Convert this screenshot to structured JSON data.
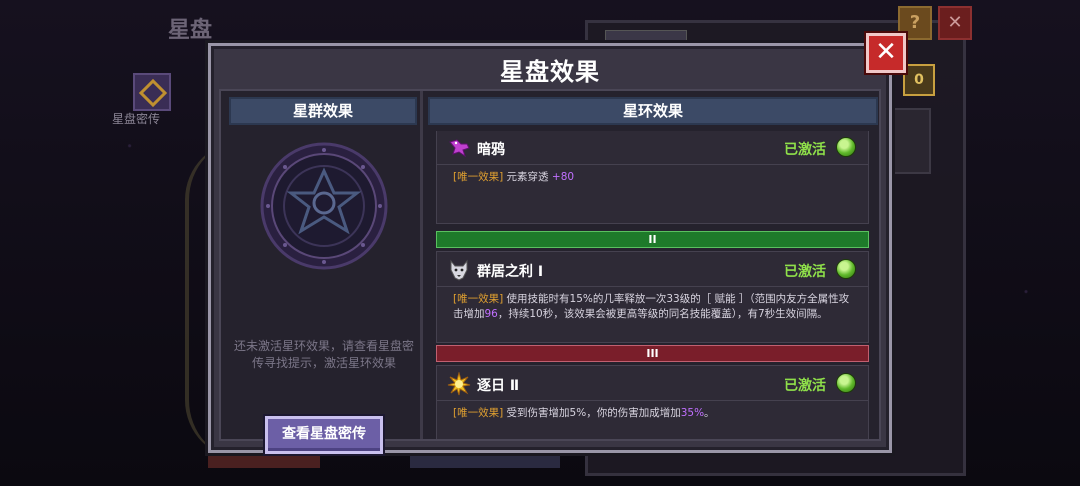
{
  "background": {
    "title": "星盘",
    "left_icon_label": "星盘密传",
    "help_icon": "?",
    "coin_label": "0"
  },
  "modal": {
    "title": "星盘效果",
    "close_icon": "close-icon",
    "left_panel": {
      "header": "星群效果",
      "hint": "还未激活星环效果，请查看星盘密传寻找提示，激活星环效果",
      "button_label": "查看星盘密传"
    },
    "right_panel": {
      "header": "星环效果",
      "entries": [
        {
          "icon": "crow-icon",
          "name": "暗鸦",
          "status": "已激活",
          "tag": "[唯一效果]",
          "desc_prefix": " 元素穿透 ",
          "desc_hl": "+80",
          "desc_suffix": ""
        },
        {
          "icon": "wolf-icon",
          "name": "群居之利 Ⅰ",
          "status": "已激活",
          "tag": "[唯一效果]",
          "desc_a": " 使用技能时有15%的几率释放一次33级的［ 赋能 ］（范围内友方全属性攻击增加",
          "desc_hl": "96",
          "desc_b": "，持续10秒，该效果会被更高等级的同名技能覆盖），有7秒生效间隔。"
        },
        {
          "icon": "sun-icon",
          "name": "逐日 Ⅱ",
          "status": "已激活",
          "tag": "[唯一效果]",
          "desc_a": " 受到伤害增加5%，你的伤害加成增加",
          "desc_hl": "35%",
          "desc_b": "。"
        }
      ],
      "tier_2": "II",
      "tier_3": "III"
    }
  },
  "colors": {
    "active_green": "#8fe04a",
    "tag_orange": "#e0a030",
    "highlight_purple": "#c070ff",
    "tier_green": "#1e7a2a",
    "tier_red": "#7a1e2a"
  }
}
